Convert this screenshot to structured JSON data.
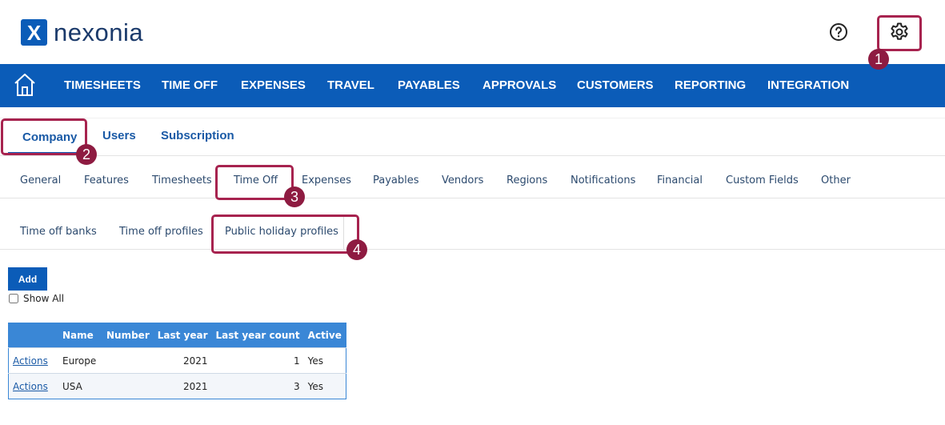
{
  "brand": {
    "logo_mark": "X",
    "name": "nexonia"
  },
  "header": {
    "help_icon": "question-circle",
    "settings_icon": "gear"
  },
  "nav": {
    "home_icon": "home",
    "items": [
      "TIMESHEETS",
      "TIME OFF",
      "EXPENSES",
      "TRAVEL",
      "PAYABLES",
      "APPROVALS",
      "CUSTOMERS",
      "REPORTING",
      "INTEGRATION"
    ]
  },
  "tabs_level1": [
    "Company",
    "Users",
    "Subscription"
  ],
  "tabs_level2": [
    "General",
    "Features",
    "Timesheets",
    "Time Off",
    "Expenses",
    "Payables",
    "Vendors",
    "Regions",
    "Notifications",
    "Financial",
    "Custom Fields",
    "Other"
  ],
  "tabs_level3": [
    "Time off banks",
    "Time off profiles",
    "Public holiday profiles"
  ],
  "badges": [
    "1",
    "2",
    "3",
    "4"
  ],
  "actions": {
    "add_label": "Add",
    "show_all_label": "Show All"
  },
  "table": {
    "headers": [
      "",
      "Name",
      "Number",
      "Last year",
      "Last year count",
      "Active"
    ],
    "rows": [
      {
        "action": "Actions",
        "name": "Europe",
        "number": "",
        "last_year": "2021",
        "last_year_count": "1",
        "active": "Yes"
      },
      {
        "action": "Actions",
        "name": "USA",
        "number": "",
        "last_year": "2021",
        "last_year_count": "3",
        "active": "Yes"
      }
    ]
  },
  "colors": {
    "brand_blue": "#0b5cb8",
    "highlight": "#a7234f",
    "badge": "#8e1b41",
    "table_header": "#3a87d6"
  }
}
